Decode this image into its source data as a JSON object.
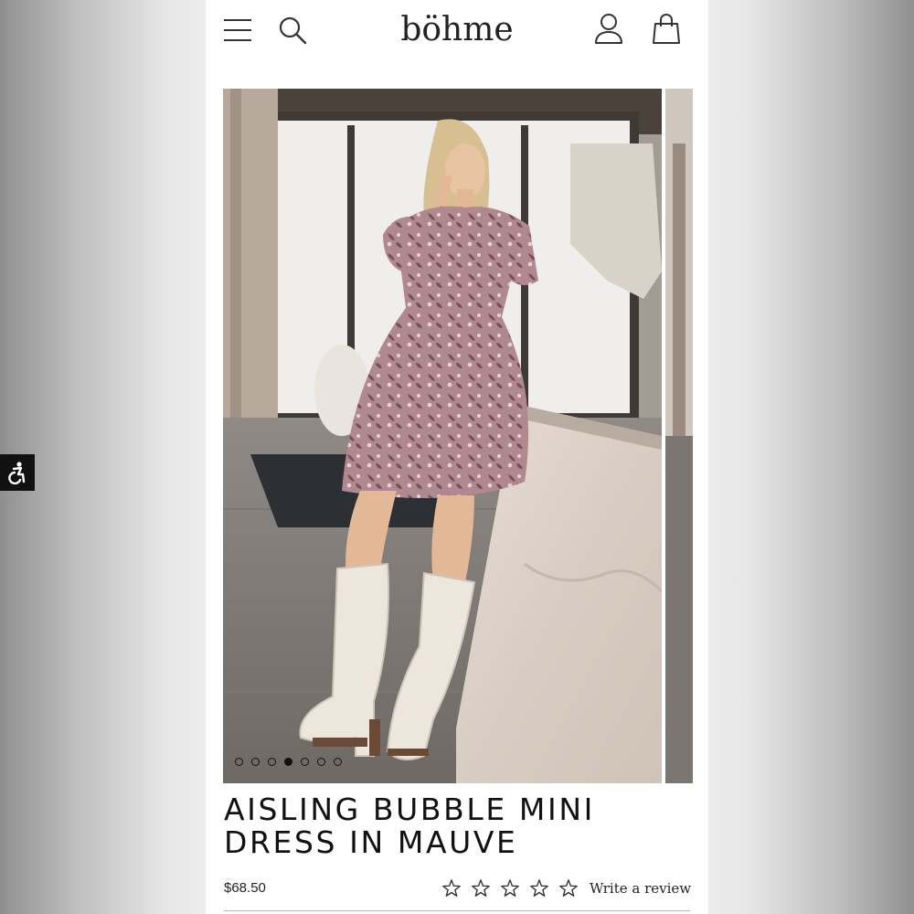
{
  "header": {
    "logo": "böhme",
    "icons": [
      "menu-icon",
      "search-icon",
      "account-icon",
      "cart-icon"
    ]
  },
  "gallery": {
    "slide_count": 7,
    "active_index": 3,
    "image_alt": "Model wearing mauve floral bubble mini dress with cream knee-high boots"
  },
  "accessibility": {
    "icon": "accessibility-icon"
  },
  "product": {
    "title": "AISLING BUBBLE MINI DRESS IN MAUVE",
    "price": "$68.50",
    "rating_stars": 5,
    "review_link": "Write a review"
  },
  "colors": {
    "text": "#111111",
    "dress": "#a98088",
    "boots": "#ece6dc",
    "page_bg": "#ededed"
  }
}
